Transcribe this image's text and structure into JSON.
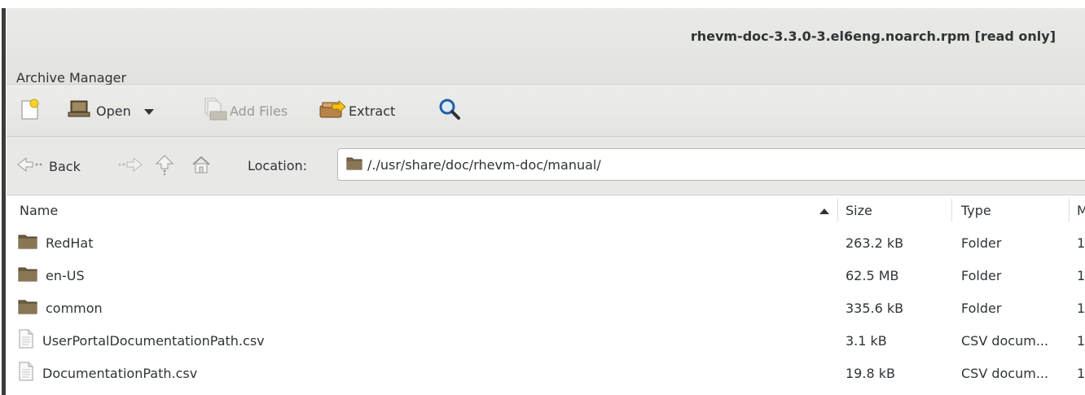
{
  "window": {
    "title": "rhevm-doc-3.3.0-3.el6eng.noarch.rpm [read only]",
    "app_name": "Archive Manager"
  },
  "toolbar": {
    "new_icon": "new-archive-icon",
    "open_label": "Open",
    "add_files_label": "Add Files",
    "extract_label": "Extract",
    "find_icon": "search-icon"
  },
  "navbar": {
    "back_label": "Back",
    "location_label": "Location:",
    "location_value": "/./usr/share/doc/rhevm-doc/manual/"
  },
  "columns": {
    "name": "Name",
    "size": "Size",
    "type": "Type",
    "modified": "M"
  },
  "files": [
    {
      "name": "RedHat",
      "size": "263.2 kB",
      "type": "Folder",
      "modified": "1",
      "icon": "folder-icon"
    },
    {
      "name": "en-US",
      "size": "62.5 MB",
      "type": "Folder",
      "modified": "1",
      "icon": "folder-icon"
    },
    {
      "name": "common",
      "size": "335.6 kB",
      "type": "Folder",
      "modified": "1",
      "icon": "folder-icon"
    },
    {
      "name": "UserPortalDocumentationPath.csv",
      "size": "3.1 kB",
      "type": "CSV docum...",
      "modified": "1",
      "icon": "document-icon"
    },
    {
      "name": "DocumentationPath.csv",
      "size": "19.8 kB",
      "type": "CSV docum...",
      "modified": "1",
      "icon": "document-icon"
    }
  ],
  "colors": {
    "folder": "#8a7654",
    "accent": "#1e5fa8"
  }
}
